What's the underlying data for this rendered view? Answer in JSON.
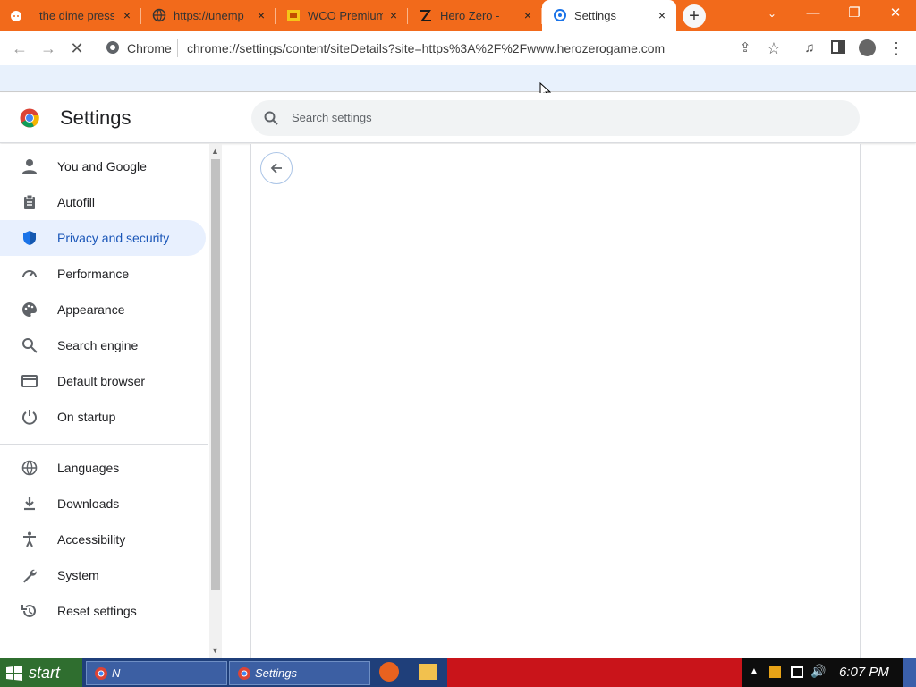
{
  "tabs": [
    {
      "label": "the dime press",
      "favicon": "reddit-icon"
    },
    {
      "label": "https://unemp",
      "favicon": "globe-icon"
    },
    {
      "label": "WCO Premium",
      "favicon": "wco-icon"
    },
    {
      "label": "Hero Zero - ",
      "favicon": "hero-zero-icon"
    },
    {
      "label": "Settings",
      "favicon": "settings-icon"
    }
  ],
  "tab_close": "×",
  "new_tab": "+",
  "window": {
    "minimize": "—",
    "restore": "❐",
    "close": "✕"
  },
  "omnibox": {
    "site_chip": "Chrome",
    "url": "chrome://settings/content/siteDetails?site=https%3A%2F%2Fwww.herozerogame.com"
  },
  "settings": {
    "title": "Settings",
    "search_placeholder": "Search settings"
  },
  "sidebar": {
    "items": [
      {
        "label": "You and Google",
        "icon": "person-icon"
      },
      {
        "label": "Autofill",
        "icon": "clipboard-icon"
      },
      {
        "label": "Privacy and security",
        "icon": "shield-icon"
      },
      {
        "label": "Performance",
        "icon": "speedometer-icon"
      },
      {
        "label": "Appearance",
        "icon": "palette-icon"
      },
      {
        "label": "Search engine",
        "icon": "search-icon"
      },
      {
        "label": "Default browser",
        "icon": "browser-icon"
      },
      {
        "label": "On startup",
        "icon": "power-icon"
      },
      {
        "label": "Languages",
        "icon": "globe-icon"
      },
      {
        "label": "Downloads",
        "icon": "download-icon"
      },
      {
        "label": "Accessibility",
        "icon": "accessibility-icon"
      },
      {
        "label": "System",
        "icon": "wrench-icon"
      },
      {
        "label": "Reset settings",
        "icon": "reset-icon"
      }
    ],
    "active_index": 2
  },
  "taskbar": {
    "start": "start",
    "tasks": [
      "N",
      "Settings"
    ],
    "clock": "6:07 PM"
  },
  "colors": {
    "tabstrip": "#f26a1b",
    "accent": "#1a73e8",
    "active_nav_bg": "#e8f0fe"
  }
}
